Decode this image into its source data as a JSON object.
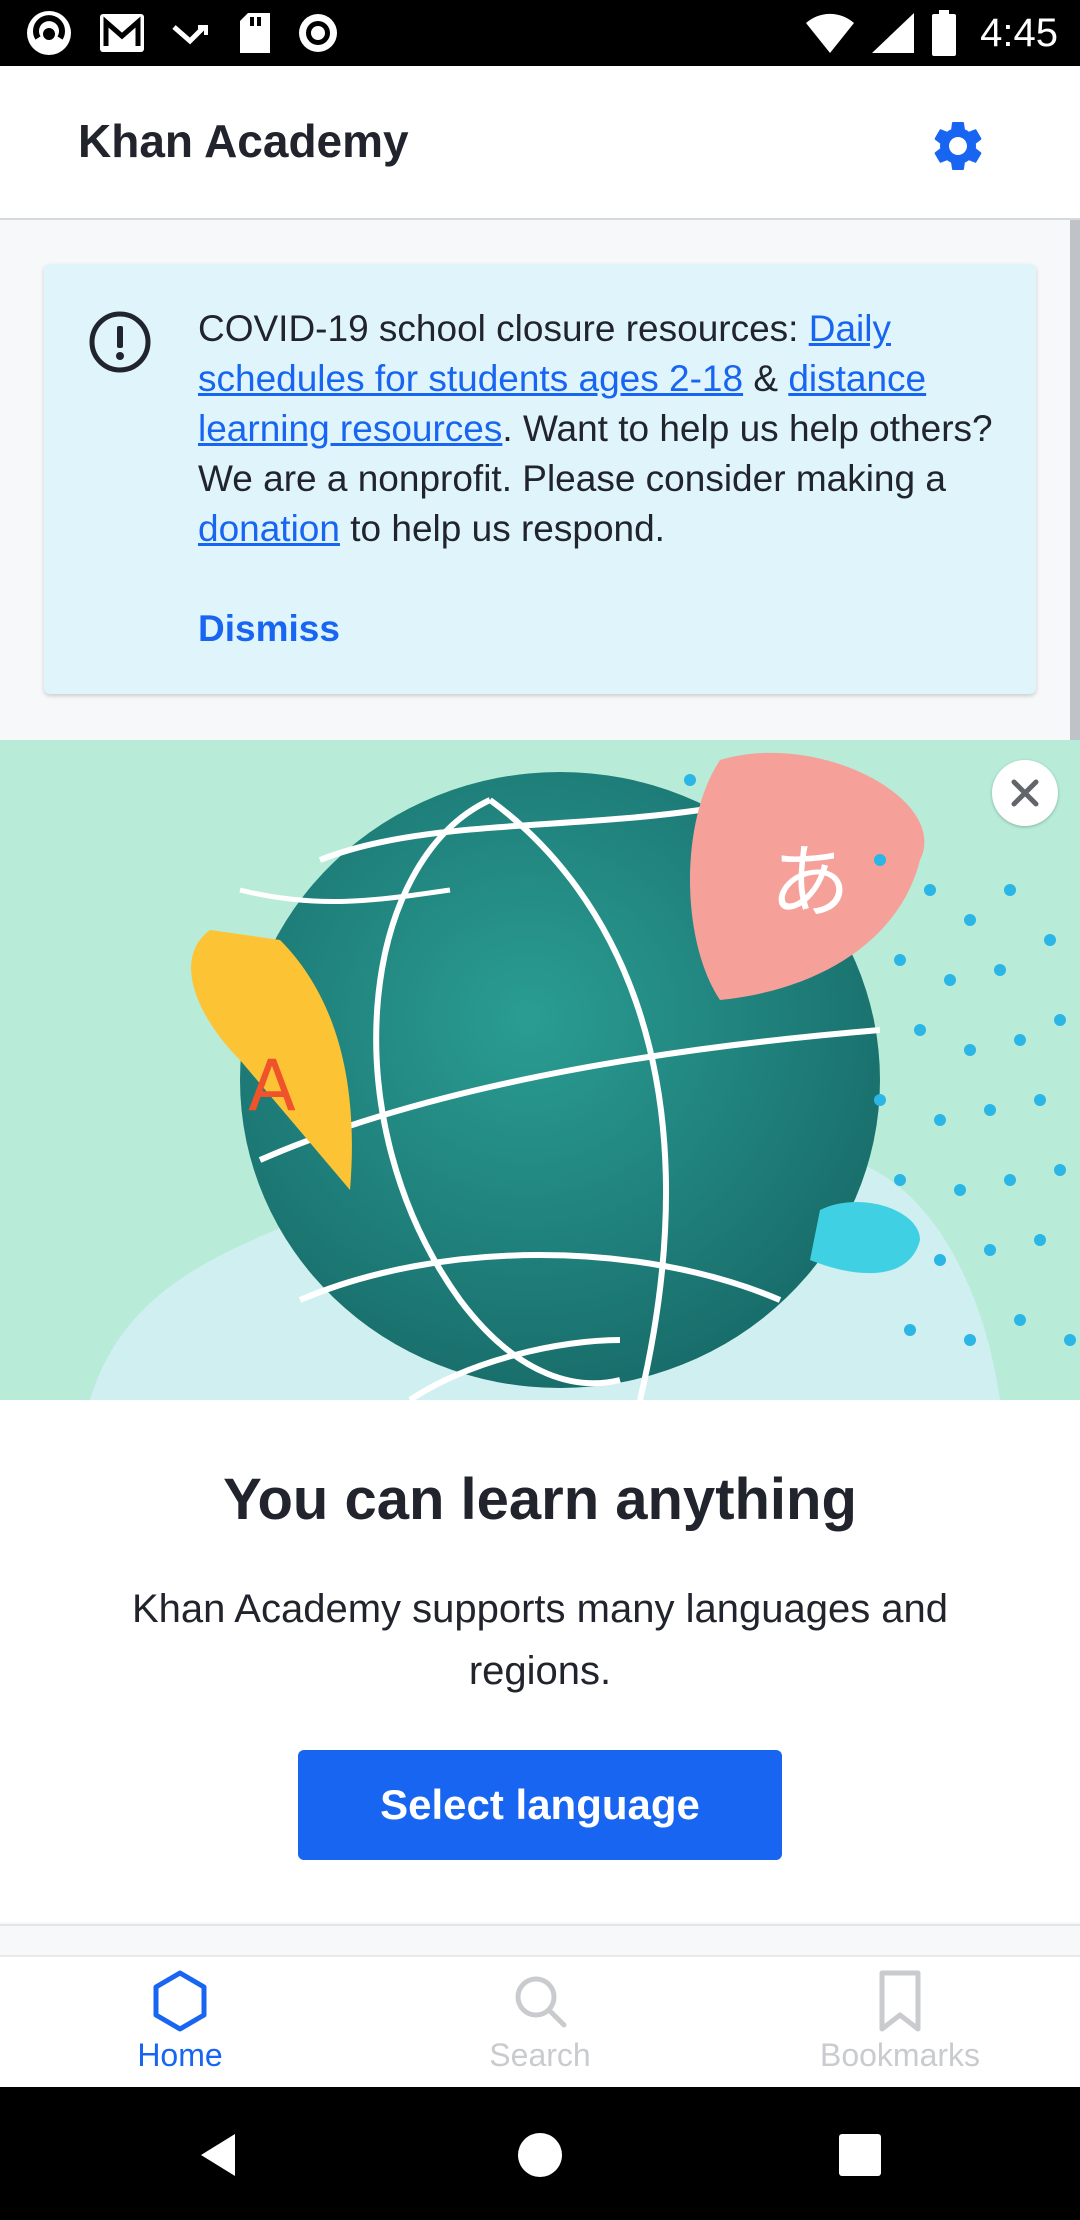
{
  "status_bar": {
    "time": "4:45",
    "left_icons": [
      "app-icon",
      "gmail-icon",
      "missed-call-icon",
      "sd-card-icon",
      "record-icon"
    ],
    "right_icons": [
      "wifi-icon",
      "cellular-signal-icon",
      "battery-icon"
    ]
  },
  "app_bar": {
    "title": "Khan Academy",
    "settings_icon": "gear-icon"
  },
  "banner": {
    "text_intro": "COVID-19 school closure resources: ",
    "link_schedules": "Daily schedules for students ages 2-18",
    "text_and": " & ",
    "link_distance": "distance learning resources",
    "text_middle": ". Want to help us help others? We are a nonprofit. Please consider making a ",
    "link_donation": "donation",
    "text_end": " to help us respond.",
    "dismiss_label": "Dismiss"
  },
  "hero": {
    "bubble_left_char": "A",
    "bubble_right_char": "あ"
  },
  "promo": {
    "title": "You can learn anything",
    "description": "Khan Academy supports many languages and regions.",
    "button_label": "Select language"
  },
  "bottom_nav": {
    "items": [
      {
        "label": "Home",
        "icon": "hexagon-icon",
        "active": true
      },
      {
        "label": "Search",
        "icon": "search-icon",
        "active": false
      },
      {
        "label": "Bookmarks",
        "icon": "bookmark-icon",
        "active": false
      }
    ]
  },
  "colors": {
    "accent": "#1865f2",
    "banner_bg": "#dff5fb",
    "hero_bg": "#b8ecd9",
    "text": "#21242c",
    "inactive": "#c9cbcf"
  }
}
